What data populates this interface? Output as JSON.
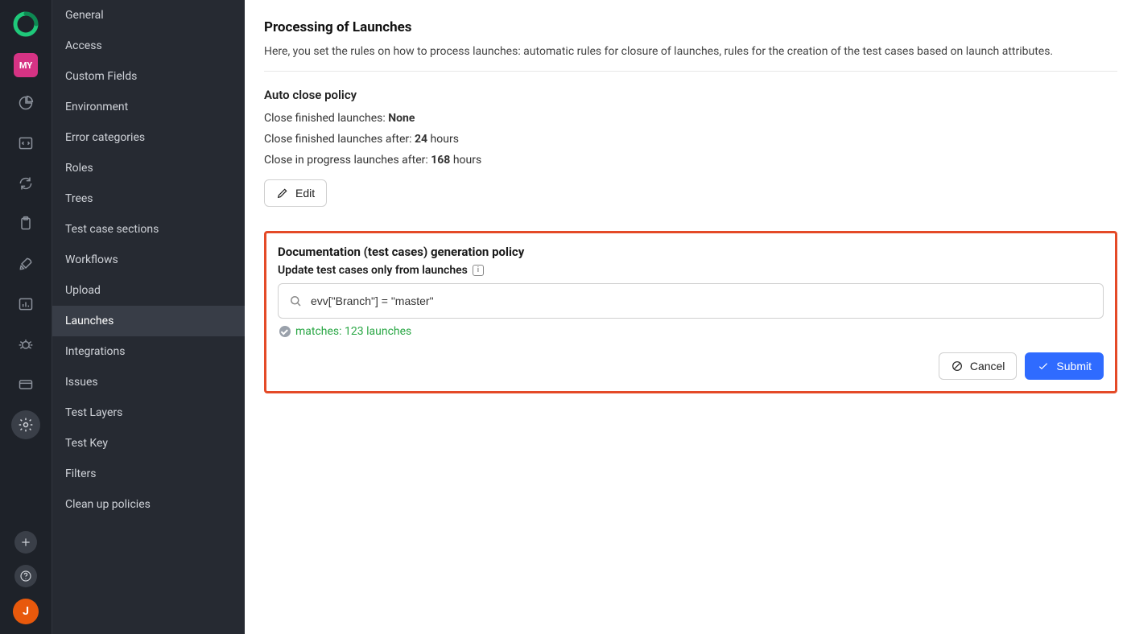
{
  "iconrail": {
    "project_badge": "MY",
    "user_initial": "J"
  },
  "settings_nav": {
    "items": [
      {
        "label": "General"
      },
      {
        "label": "Access"
      },
      {
        "label": "Custom Fields"
      },
      {
        "label": "Environment"
      },
      {
        "label": "Error categories"
      },
      {
        "label": "Roles"
      },
      {
        "label": "Trees"
      },
      {
        "label": "Test case sections"
      },
      {
        "label": "Workflows"
      },
      {
        "label": "Upload"
      },
      {
        "label": "Launches",
        "active": true
      },
      {
        "label": "Integrations"
      },
      {
        "label": "Issues"
      },
      {
        "label": "Test Layers"
      },
      {
        "label": "Test Key"
      },
      {
        "label": "Filters"
      },
      {
        "label": "Clean up policies"
      }
    ]
  },
  "page": {
    "title": "Processing of Launches",
    "lead": "Here, you set the rules on how to process launches: automatic rules for closure of launches, rules for the creation of the test cases based on launch attributes."
  },
  "auto_close": {
    "heading": "Auto close policy",
    "line1_prefix": "Close finished launches: ",
    "line1_value": "None",
    "line2_prefix": "Close finished launches after: ",
    "line2_value": "24",
    "line2_suffix": " hours",
    "line3_prefix": "Close in progress launches after: ",
    "line3_value": "168",
    "line3_suffix": " hours",
    "edit_label": "Edit"
  },
  "doc_gen": {
    "heading": "Documentation (test cases) generation policy",
    "sub_label": "Update test cases only from launches",
    "query": "evv[\"Branch\"] = \"master\"",
    "match_text": "matches: 123 launches",
    "cancel_label": "Cancel",
    "submit_label": "Submit"
  }
}
